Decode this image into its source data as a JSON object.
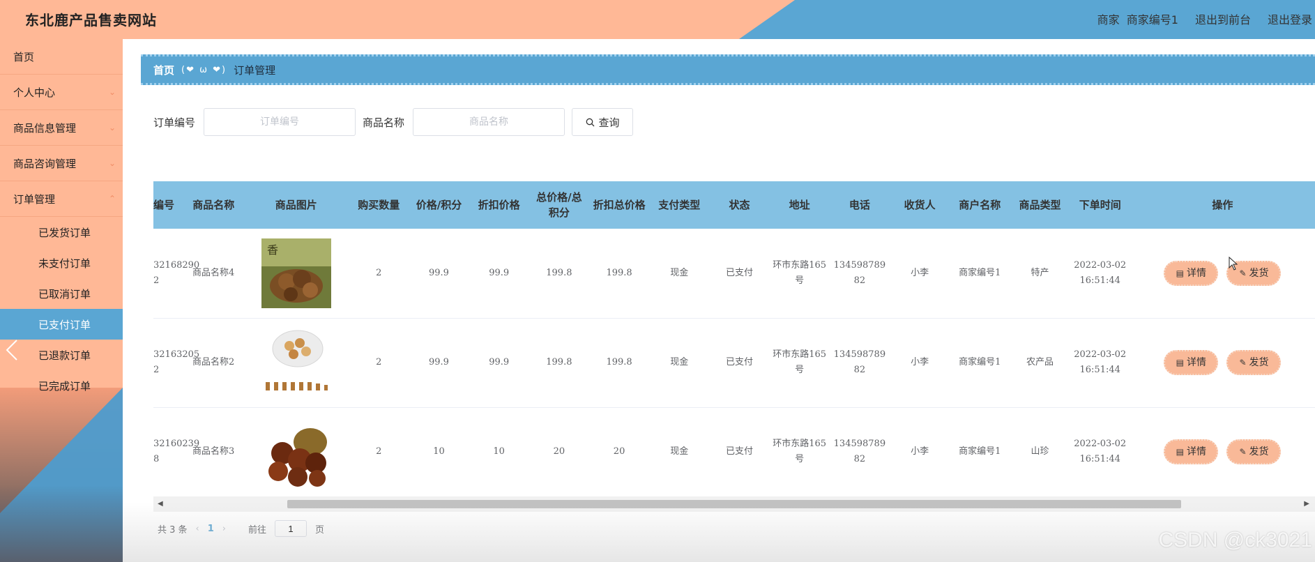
{
  "header": {
    "title": "东北鹿产品售卖网站",
    "role_label": "商家",
    "user_name": "商家编号1",
    "back_to_front_label": "退出到前台",
    "logout_label": "退出登录"
  },
  "sidebar": {
    "items": [
      {
        "label": "首页"
      },
      {
        "label": "个人中心"
      },
      {
        "label": "商品信息管理"
      },
      {
        "label": "商品咨询管理"
      },
      {
        "label": "订单管理"
      }
    ],
    "order_submenu": [
      {
        "label": "已发货订单"
      },
      {
        "label": "未支付订单"
      },
      {
        "label": "已取消订单"
      },
      {
        "label": "已支付订单"
      },
      {
        "label": "已退款订单"
      },
      {
        "label": "已完成订单"
      }
    ]
  },
  "breadcrumb": {
    "home": "首页",
    "separator": "(❤ ω ❤)",
    "current": "订单管理"
  },
  "search": {
    "order_no_label": "订单编号",
    "order_no_placeholder": "订单编号",
    "product_name_label": "商品名称",
    "product_name_placeholder": "商品名称",
    "query_label": "查询"
  },
  "table": {
    "headers": [
      "编号",
      "商品名称",
      "商品图片",
      "购买数量",
      "价格/积分",
      "折扣价格",
      "总价格/总积分",
      "折扣总价格",
      "支付类型",
      "状态",
      "地址",
      "电话",
      "收货人",
      "商户名称",
      "商品类型",
      "下单时间",
      "操作"
    ],
    "detail_label": "详情",
    "ship_label": "发货",
    "rows": [
      {
        "id": "32168290 2",
        "name": "商品名称4",
        "image": "dried-mushroom-photo",
        "qty": "2",
        "price": "99.9",
        "discount_price": "99.9",
        "total": "199.8",
        "discount_total": "199.8",
        "pay_type": "现金",
        "status": "已支付",
        "address": "环市东路165号",
        "phone": "13459878982",
        "receiver": "小李",
        "merchant": "商家编号1",
        "category": "特产",
        "order_time": "2022-03-02 16:51:44"
      },
      {
        "id": "32163205 2",
        "name": "商品名称2",
        "image": "nuts-plate-photo",
        "qty": "2",
        "price": "99.9",
        "discount_price": "99.9",
        "total": "199.8",
        "discount_total": "199.8",
        "pay_type": "现金",
        "status": "已支付",
        "address": "环市东路165号",
        "phone": "13459878982",
        "receiver": "小李",
        "merchant": "商家编号1",
        "category": "农产品",
        "order_time": "2022-03-02 16:51:44"
      },
      {
        "id": "32160239 8",
        "name": "商品名称3",
        "image": "chestnuts-photo",
        "qty": "2",
        "price": "10",
        "discount_price": "10",
        "total": "20",
        "discount_total": "20",
        "pay_type": "现金",
        "status": "已支付",
        "address": "环市东路165号",
        "phone": "13459878982",
        "receiver": "小李",
        "merchant": "商家编号1",
        "category": "山珍",
        "order_time": "2022-03-02 16:51:44"
      }
    ]
  },
  "pagination": {
    "total_text": "共 3 条",
    "current_page": "1",
    "goto_label": "前往",
    "goto_value": "1",
    "page_suffix": "页"
  },
  "watermark": "CSDN @ck3021",
  "colors": {
    "accent_orange": "#ffb896",
    "accent_blue": "#5aa6d3",
    "table_header": "#84c1e3"
  }
}
